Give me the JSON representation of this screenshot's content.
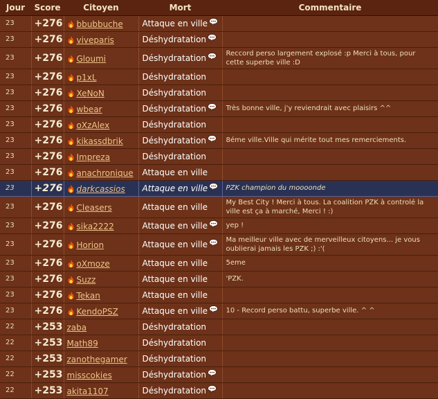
{
  "headers": {
    "jour": "Jour",
    "score": "Score",
    "citoyen": "Citoyen",
    "mort": "Mort",
    "commentaire": "Commentaire"
  },
  "rows": [
    {
      "jour": "23",
      "score": "+276",
      "name": "bbubbuche",
      "hero": true,
      "mort": "Attaque en ville",
      "bubble": true,
      "comment": ""
    },
    {
      "jour": "23",
      "score": "+276",
      "name": "viveparis",
      "hero": true,
      "mort": "Déshydratation",
      "bubble": true,
      "comment": ""
    },
    {
      "jour": "23",
      "score": "+276",
      "name": "Gloumi",
      "hero": true,
      "mort": "Déshydratation",
      "bubble": true,
      "comment": "Reccord perso largement explosé :p Merci à tous, pour cette superbe ville :D"
    },
    {
      "jour": "23",
      "score": "+276",
      "name": "p1xL",
      "hero": true,
      "mort": "Déshydratation",
      "bubble": false,
      "comment": ""
    },
    {
      "jour": "23",
      "score": "+276",
      "name": "XeNoN",
      "hero": true,
      "mort": "Déshydratation",
      "bubble": false,
      "comment": ""
    },
    {
      "jour": "23",
      "score": "+276",
      "name": "wbear",
      "hero": true,
      "mort": "Déshydratation",
      "bubble": true,
      "comment": "Très bonne ville, j'y reviendrait avec plaisirs ^^"
    },
    {
      "jour": "23",
      "score": "+276",
      "name": "oXzAlex",
      "hero": true,
      "mort": "Déshydratation",
      "bubble": false,
      "comment": ""
    },
    {
      "jour": "23",
      "score": "+276",
      "name": "kikassdbrik",
      "hero": true,
      "mort": "Déshydratation",
      "bubble": true,
      "comment": "8éme ville.Ville qui mérite tout mes remerciements."
    },
    {
      "jour": "23",
      "score": "+276",
      "name": "Impreza",
      "hero": true,
      "mort": "Déshydratation",
      "bubble": false,
      "comment": ""
    },
    {
      "jour": "23",
      "score": "+276",
      "name": "anachronique",
      "hero": true,
      "mort": "Attaque en ville",
      "bubble": false,
      "comment": ""
    },
    {
      "jour": "23",
      "score": "+276",
      "name": "darkcassios",
      "hero": true,
      "mort": "Attaque en ville",
      "bubble": true,
      "comment": "PZK champion du moooonde",
      "highlight": true
    },
    {
      "jour": "23",
      "score": "+276",
      "name": "Cleasers",
      "hero": true,
      "mort": "Attaque en ville",
      "bubble": false,
      "comment": "My Best City ! Merci à tous. La coalition PZK à controlé la ville est ça à marché, Merci ! :)"
    },
    {
      "jour": "23",
      "score": "+276",
      "name": "sika2222",
      "hero": true,
      "mort": "Attaque en ville",
      "bubble": true,
      "comment": "yep !"
    },
    {
      "jour": "23",
      "score": "+276",
      "name": "Horion",
      "hero": true,
      "mort": "Attaque en ville",
      "bubble": true,
      "comment": "Ma meilleur ville avec de merveilleux citoyens... je vous oublierai jamais les PZK ;) :'("
    },
    {
      "jour": "23",
      "score": "+276",
      "name": "oXmoze",
      "hero": true,
      "mort": "Attaque en ville",
      "bubble": false,
      "comment": "5eme"
    },
    {
      "jour": "23",
      "score": "+276",
      "name": "Suzz",
      "hero": true,
      "mort": "Attaque en ville",
      "bubble": false,
      "comment": "'PZK."
    },
    {
      "jour": "23",
      "score": "+276",
      "name": "Tekan",
      "hero": true,
      "mort": "Attaque en ville",
      "bubble": false,
      "comment": ""
    },
    {
      "jour": "23",
      "score": "+276",
      "name": "KendoPSZ",
      "hero": true,
      "mort": "Attaque en ville",
      "bubble": true,
      "comment": "10 - Record perso battu, superbe ville. ^ ^"
    },
    {
      "jour": "22",
      "score": "+253",
      "name": "zaba",
      "hero": false,
      "mort": "Déshydratation",
      "bubble": false,
      "comment": ""
    },
    {
      "jour": "22",
      "score": "+253",
      "name": "Math89",
      "hero": false,
      "mort": "Déshydratation",
      "bubble": false,
      "comment": ""
    },
    {
      "jour": "22",
      "score": "+253",
      "name": "zanothegamer",
      "hero": false,
      "mort": "Déshydratation",
      "bubble": false,
      "comment": ""
    },
    {
      "jour": "22",
      "score": "+253",
      "name": "misscokies",
      "hero": false,
      "mort": "Déshydratation",
      "bubble": true,
      "comment": ""
    },
    {
      "jour": "22",
      "score": "+253",
      "name": "akita1107",
      "hero": false,
      "mort": "Déshydratation",
      "bubble": true,
      "comment": ""
    }
  ],
  "icons": {
    "hero": "flame-icon",
    "comment": "speech-bubble-icon"
  },
  "colors": {
    "row_background": "#6d3219",
    "highlight_row": "#293254",
    "header_text": "#f3e3c1",
    "citizen_link": "#efc48a"
  }
}
